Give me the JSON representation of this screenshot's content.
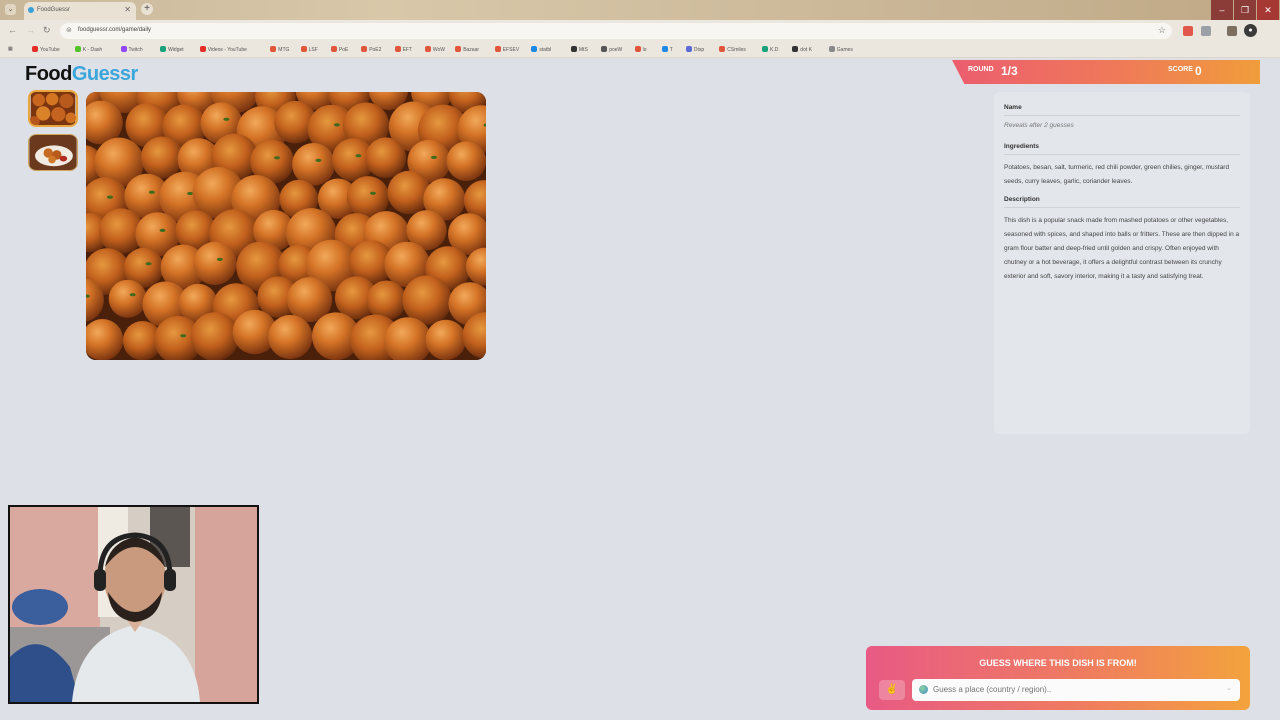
{
  "browser": {
    "tab_title": "FoodGuessr",
    "tab_close": "✕",
    "new_tab": "+",
    "url": "foodguessr.com/game/daily",
    "bookmarks": [
      {
        "label": "YouTube",
        "color": "#e52d27"
      },
      {
        "label": "K - Dash",
        "color": "#53c22b"
      },
      {
        "label": "Twitch",
        "color": "#9146ff"
      },
      {
        "label": "Widget",
        "color": "#1aa37a"
      },
      {
        "label": "Videos - YouTube",
        "color": "#e52d27"
      },
      {
        "label": "MTG",
        "color": "#e0563b"
      },
      {
        "label": "LSF",
        "color": "#e0563b"
      },
      {
        "label": "PoE",
        "color": "#e0563b"
      },
      {
        "label": "PoE2",
        "color": "#e0563b"
      },
      {
        "label": "EFT",
        "color": "#e0563b"
      },
      {
        "label": "WoW",
        "color": "#e0563b"
      },
      {
        "label": "Bazaar",
        "color": "#e0563b"
      },
      {
        "label": "EFSEV",
        "color": "#e0563b"
      },
      {
        "label": "statbl",
        "color": "#1e88e5"
      },
      {
        "label": "MtS",
        "color": "#333333"
      },
      {
        "label": "poeW",
        "color": "#555555"
      },
      {
        "label": "lo",
        "color": "#e0563b"
      },
      {
        "label": "T",
        "color": "#1e88e5"
      },
      {
        "label": "Dtsp",
        "color": "#5b6bd6"
      },
      {
        "label": "CSmiles",
        "color": "#e0563b"
      },
      {
        "label": "K.D",
        "color": "#1aa37a"
      },
      {
        "label": "dot K",
        "color": "#333333"
      },
      {
        "label": "Games",
        "color": "#888888"
      }
    ]
  },
  "logo": {
    "part1": "Food",
    "part2": "Guessr"
  },
  "round": {
    "label": "ROUND",
    "value": "1/3"
  },
  "score": {
    "label": "SCORE",
    "value": "0"
  },
  "info": {
    "name_heading": "Name",
    "name_note": "Reveals after 2 guesses",
    "ingredients_heading": "Ingredients",
    "ingredients": "Potatoes, besan, salt, turmeric, red chili powder, green chilies, ginger, mustard seeds, curry leaves, garlic, coriander leaves.",
    "description_heading": "Description",
    "description": "This dish is a popular snack made from mashed potatoes or other vegetables, seasoned with spices, and shaped into balls or fritters. These are then dipped in a gram flour batter and deep-fried until golden and crispy. Often enjoyed with chutney or a hot beverage, it offers a delightful contrast between its crunchy exterior and soft, savory interior, making it a tasty and satisfying treat."
  },
  "guess": {
    "title": "GUESS WHERE THIS DISH IS FROM!",
    "placeholder": "Guess a place (country / region).."
  },
  "colors": {
    "accent_blue": "#3aa6dc",
    "banner_start": "#ec5d6f",
    "banner_end": "#f09d3b"
  }
}
